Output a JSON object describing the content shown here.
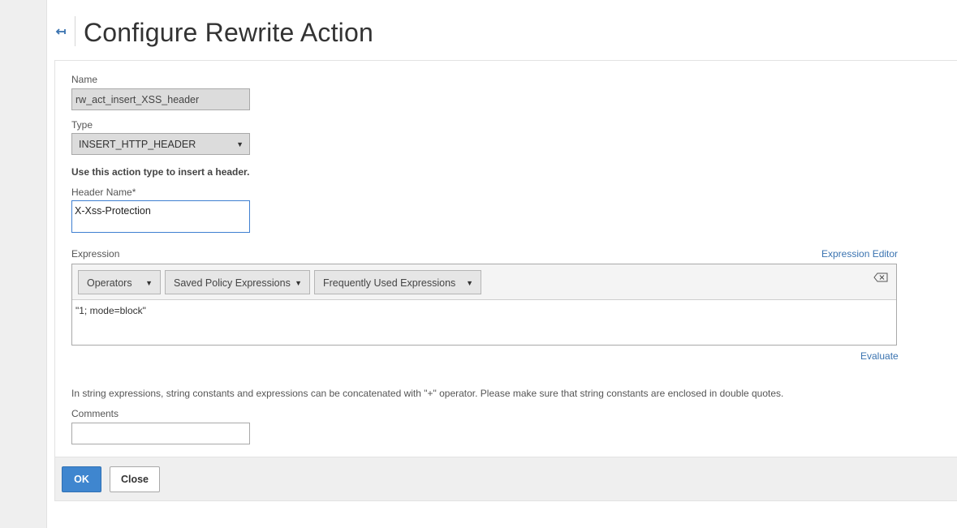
{
  "header": {
    "back_icon": "back-arrow-icon",
    "title": "Configure Rewrite Action"
  },
  "form": {
    "name": {
      "label": "Name",
      "value": "rw_act_insert_XSS_header"
    },
    "type": {
      "label": "Type",
      "selected": "INSERT_HTTP_HEADER",
      "caret": "▼"
    },
    "type_hint": "Use this action type to insert a header.",
    "header_name": {
      "label": "Header Name*",
      "value": "X-Xss-Protection"
    },
    "expression": {
      "label": "Expression",
      "editor_link": "Expression Editor",
      "toolbar": {
        "operators": "Operators",
        "saved_policy": "Saved Policy Expressions",
        "frequently_used": "Frequently Used Expressions",
        "caret": "▼",
        "clear_icon": "backspace-clear-icon"
      },
      "value": "\"1; mode=block\"",
      "evaluate_link": "Evaluate"
    },
    "info": "In string expressions, string constants and expressions can be concatenated with \"+\" operator. Please make sure that string constants are enclosed in double quotes.",
    "comments": {
      "label": "Comments",
      "value": ""
    }
  },
  "footer": {
    "ok_label": "OK",
    "close_label": "Close"
  },
  "colors": {
    "accent": "#3f86cf",
    "link": "#3a73b0",
    "focus_border": "#3f7fd1"
  }
}
